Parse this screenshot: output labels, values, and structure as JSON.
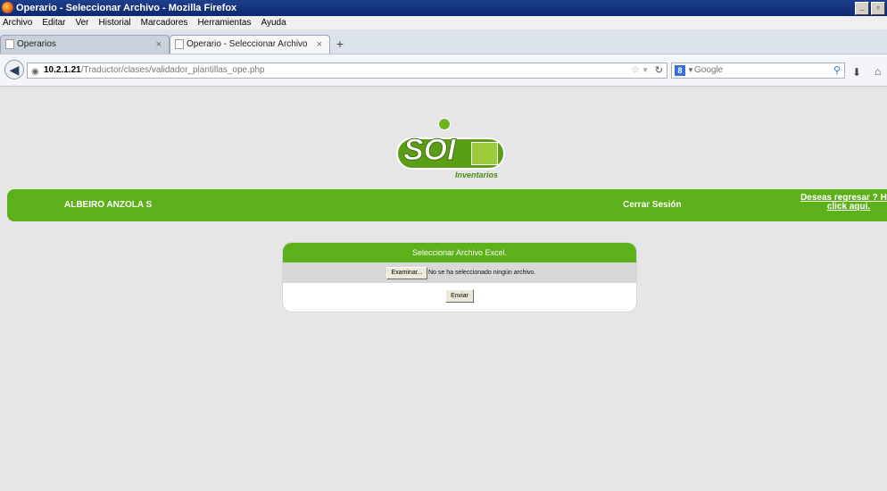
{
  "window": {
    "title": "Operario - Seleccionar Archivo - Mozilla Firefox",
    "controls": [
      "_",
      "▫"
    ]
  },
  "menu": [
    "Archivo",
    "Editar",
    "Ver",
    "Historial",
    "Marcadores",
    "Herramientas",
    "Ayuda"
  ],
  "tabs": [
    {
      "label": "Operarios",
      "close": "×"
    },
    {
      "label": "Operario - Seleccionar Archivo",
      "close": "×"
    }
  ],
  "new_tab": "+",
  "address": {
    "host": "10.2.1.21",
    "path": "/Traductor/clases/validador_plantillas_ope.php"
  },
  "search": {
    "engine_letter": "8",
    "placeholder": "Google"
  },
  "logo": {
    "text": "SOI",
    "subtitle": "Inventarios"
  },
  "header": {
    "user": "ALBEIRO ANZOLA S",
    "logout": "Cerrar Sesión",
    "back_link_1": "Deseas regresar ? Has",
    "back_link_2": "click aqui."
  },
  "upload": {
    "title": "Seleccionar Archivo Excel.",
    "browse": "Examinar...",
    "no_file": "No se ha seleccionado ningún archivo.",
    "submit": "Enviar"
  },
  "colors": {
    "accent_green": "#5cb01a",
    "titlebar_blue": "#0b2a6e"
  }
}
